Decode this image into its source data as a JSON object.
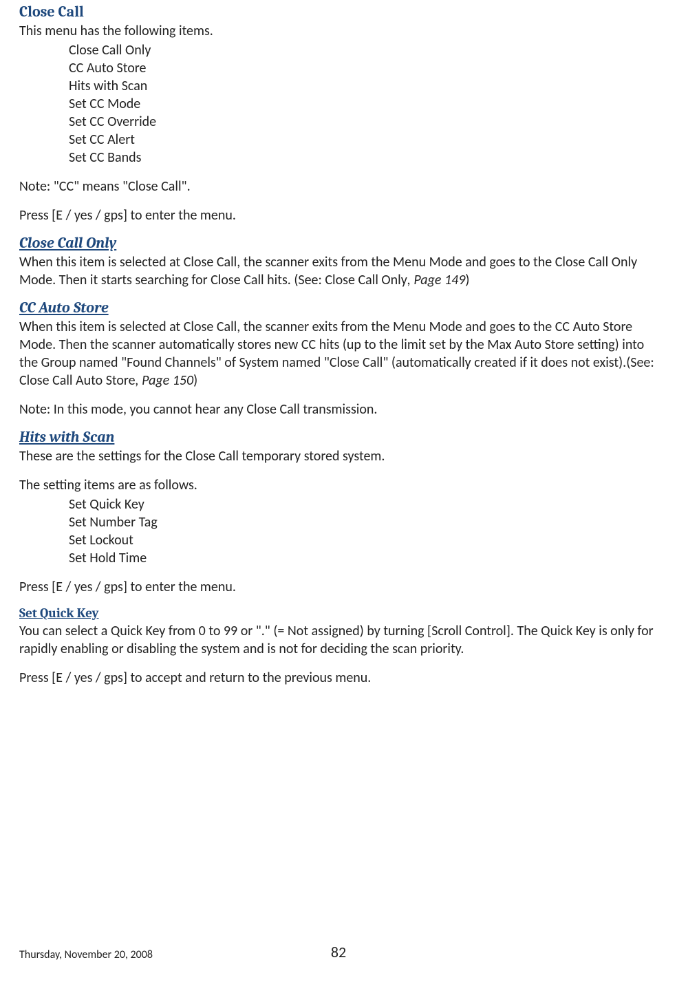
{
  "close_call": {
    "title": "Close Call",
    "intro": "This menu has the following items.",
    "items": [
      "Close Call Only",
      "CC Auto Store",
      "Hits with Scan",
      "Set CC Mode",
      "Set CC Override",
      "Set CC Alert",
      "Set CC Bands"
    ],
    "note": "Note: \"CC\" means \"Close Call\".",
    "press": "Press [E / yes / gps] to enter the menu."
  },
  "close_call_only": {
    "title": "Close Call Only",
    "body_pre": "When this item is selected at Close Call, the scanner exits from the Menu Mode and goes to the Close Call Only Mode. Then it starts searching for Close Call hits. (See: Close Call Only",
    "body_ref": ", Page 149",
    "body_post": ")"
  },
  "cc_auto_store": {
    "title": "CC Auto Store",
    "body_pre": "When this item is selected at Close Call, the scanner exits from the Menu Mode and goes to the CC Auto Store Mode. Then the scanner automatically stores new CC hits (up to the limit set by the Max Auto Store setting) into the Group named \"Found Channels\" of System named \"Close Call\" (automatically created if it does not exist).(See: Close Call Auto Store",
    "body_ref": ", Page 150",
    "body_post": ")",
    "note": "Note: In this mode, you cannot hear any Close Call transmission."
  },
  "hits_with_scan": {
    "title": "Hits with Scan",
    "intro": "These are the settings for the Close Call temporary stored system.",
    "settings_intro": "The setting items are as follows.",
    "items": [
      "Set Quick Key",
      "Set Number Tag",
      "Set Lockout",
      "Set Hold Time"
    ],
    "press": "Press [E / yes / gps] to enter the menu."
  },
  "set_quick_key": {
    "title": "Set Quick Key",
    "body": "You can select a Quick Key from 0 to 99 or \".\" (= Not assigned) by turning [Scroll Control]. The Quick Key is only for rapidly enabling or disabling the system and is not for deciding the scan priority.",
    "press": "Press [E / yes / gps] to accept and return to the previous menu."
  },
  "footer": {
    "date": "Thursday, November 20, 2008",
    "page": "82"
  }
}
